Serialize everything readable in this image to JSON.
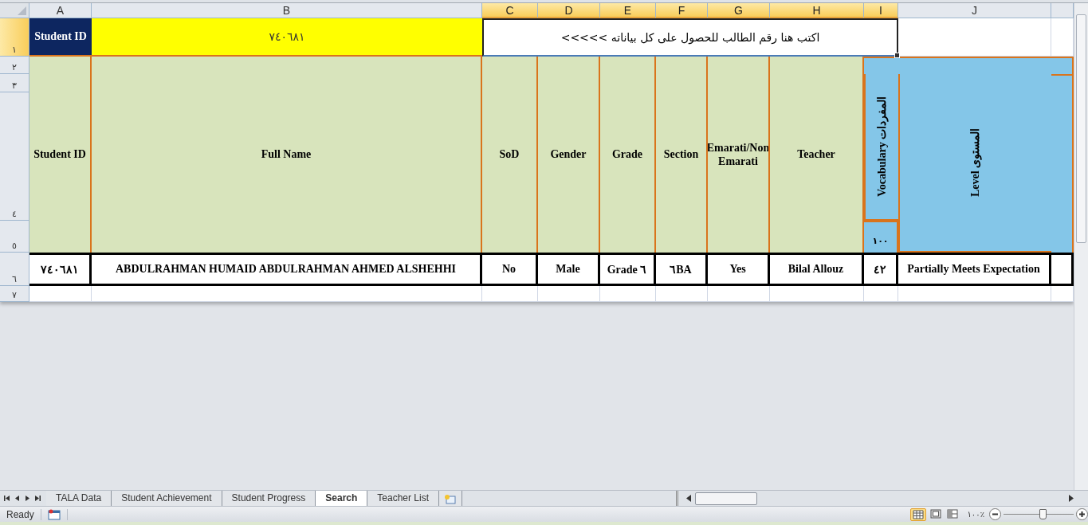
{
  "column_headers": [
    {
      "label": "A",
      "selected": false
    },
    {
      "label": "B",
      "selected": false
    },
    {
      "label": "C",
      "selected": true
    },
    {
      "label": "D",
      "selected": true
    },
    {
      "label": "E",
      "selected": true
    },
    {
      "label": "F",
      "selected": true
    },
    {
      "label": "G",
      "selected": true
    },
    {
      "label": "H",
      "selected": true
    },
    {
      "label": "I",
      "selected": true
    },
    {
      "label": "J",
      "selected": false
    }
  ],
  "row_headers": [
    {
      "label": "١",
      "selected": true
    },
    {
      "label": "٢",
      "selected": false
    },
    {
      "label": "٣",
      "selected": false
    },
    {
      "label": "٤",
      "selected": false
    },
    {
      "label": "٥",
      "selected": false
    },
    {
      "label": "٦",
      "selected": false
    },
    {
      "label": "٧",
      "selected": false
    }
  ],
  "search_row": {
    "label": "Student ID",
    "student_id": "٧٤٠٦٨١",
    "instruction": "اكتب هنا رقم الطالب للحصول على كل بياناته >>>>>"
  },
  "table": {
    "columns": [
      {
        "label": "Student ID",
        "kind": "plain"
      },
      {
        "label": "Full Name",
        "kind": "plain"
      },
      {
        "label": "SoD",
        "kind": "plain"
      },
      {
        "label": "Gender",
        "kind": "plain"
      },
      {
        "label": "Grade",
        "kind": "plain"
      },
      {
        "label": "Section",
        "kind": "plain"
      },
      {
        "label": "Emarati/Non Emarati",
        "kind": "plain"
      },
      {
        "label": "Teacher",
        "kind": "plain"
      },
      {
        "label": "Vocabulary المفردات",
        "kind": "score",
        "max": "١٠٠"
      },
      {
        "label": "Level المستوى",
        "kind": "level"
      }
    ],
    "rows": [
      [
        "٧٤٠٦٨١",
        "ABDULRAHMAN HUMAID ABDULRAHMAN AHMED ALSHEHHI",
        "No",
        "Male",
        "Grade ٦",
        "٦BA",
        "Yes",
        "Bilal Allouz",
        "٤٢",
        "Partially Meets Expectation"
      ]
    ]
  },
  "sheet_tabs": [
    {
      "label": "TALA Data",
      "selected": false
    },
    {
      "label": "Student Achievement",
      "selected": false
    },
    {
      "label": "Student Progress",
      "selected": false
    },
    {
      "label": "Search",
      "selected": true
    },
    {
      "label": "Teacher List",
      "selected": false
    }
  ],
  "status_bar": {
    "status": "Ready",
    "zoom": "١٠٠٪",
    "zoom_slider": {
      "level": 0.56
    }
  }
}
